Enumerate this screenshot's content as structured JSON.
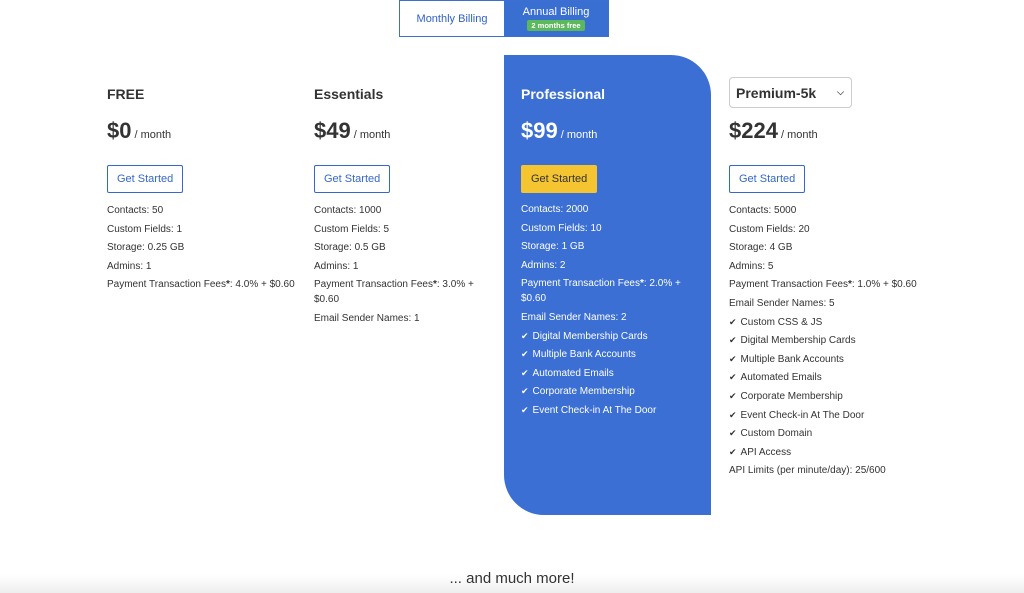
{
  "billing": {
    "monthly_label": "Monthly Billing",
    "annual_label": "Annual Billing",
    "annual_badge": "2 months free"
  },
  "plans": [
    {
      "name": "FREE",
      "price": "$0",
      "period": "/ month",
      "cta": "Get Started",
      "features": [
        "Contacts: 50",
        "Custom Fields: 1",
        "Storage: 0.25 GB",
        "Admins: 1"
      ],
      "fees_prefix": "Payment Transaction Fees",
      "fees_star": "*",
      "fees_value": ": 4.0% + $0.60"
    },
    {
      "name": "Essentials",
      "price": "$49",
      "period": "/ month",
      "cta": "Get Started",
      "features": [
        "Contacts: 1000",
        "Custom Fields: 5",
        "Storage: 0.5 GB",
        "Admins: 1"
      ],
      "fees_prefix": "Payment Transaction Fees",
      "fees_star": "*",
      "fees_value": ": 3.0% + $0.60",
      "extra": [
        "Email Sender Names: 1"
      ]
    },
    {
      "name": "Professional",
      "price": "$99",
      "period": "/ month",
      "cta": "Get Started",
      "features": [
        "Contacts: 2000",
        "Custom Fields: 10",
        "Storage: 1 GB",
        "Admins: 2"
      ],
      "fees_prefix": "Payment Transaction Fees",
      "fees_star": "*",
      "fees_value": ": 2.0% + $0.60",
      "extra": [
        "Email Sender Names: 2"
      ],
      "checks": [
        "Digital Membership Cards",
        "Multiple Bank Accounts",
        "Automated Emails",
        "Corporate Membership",
        "Event Check-in At The Door"
      ]
    },
    {
      "name": "Premium-5k",
      "price": "$224",
      "period": "/ month",
      "cta": "Get Started",
      "features": [
        "Contacts: 5000",
        "Custom Fields: 20",
        "Storage: 4 GB",
        "Admins: 5"
      ],
      "fees_prefix": "Payment Transaction Fees",
      "fees_star": "*",
      "fees_value": ": 1.0% + $0.60",
      "extra": [
        "Email Sender Names: 5"
      ],
      "checks": [
        "Custom CSS & JS",
        "Digital Membership Cards",
        "Multiple Bank Accounts",
        "Automated Emails",
        "Corporate Membership",
        "Event Check-in At The Door",
        "Custom Domain",
        "API Access"
      ],
      "tail": [
        "API Limits (per minute/day): 25/600"
      ]
    }
  ],
  "footer": {
    "more": "... and much more!"
  },
  "colors": {
    "primary": "#3b6fd3",
    "cta_highlight": "#f5c431",
    "badge": "#5cb85c"
  }
}
